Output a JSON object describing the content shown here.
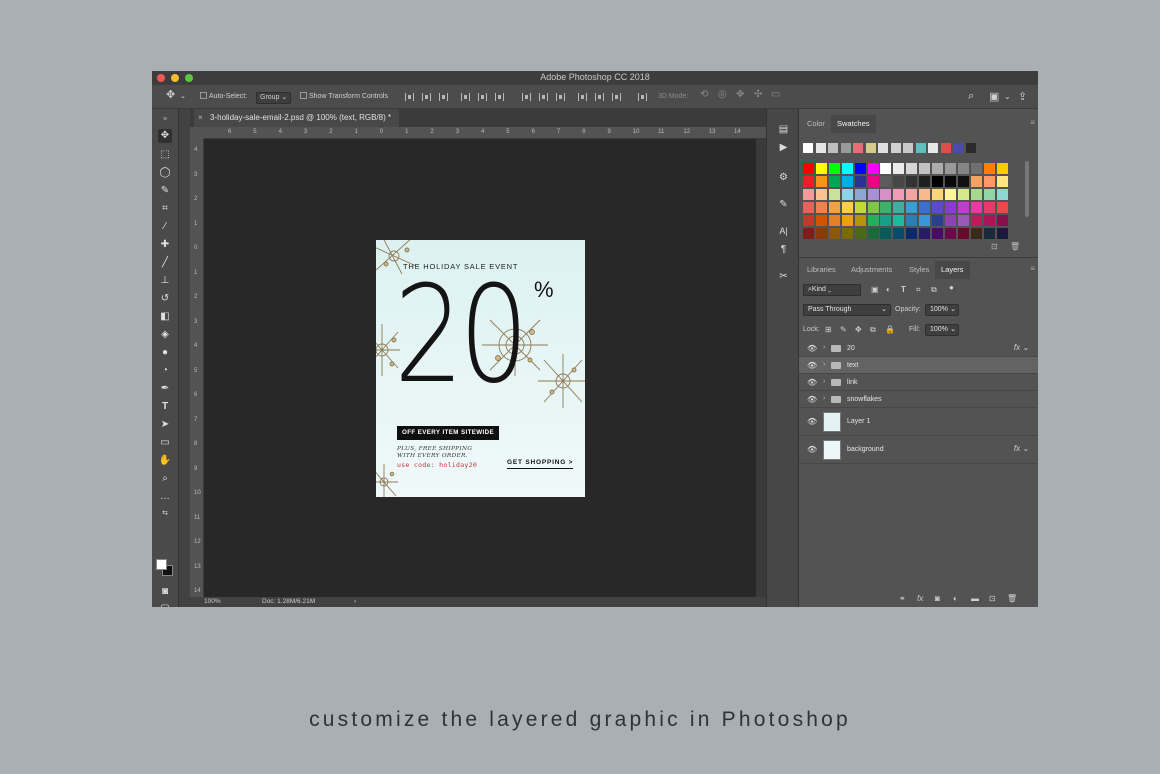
{
  "app": {
    "title": "Adobe Photoshop CC 2018"
  },
  "options_bar": {
    "move_icon": "move-icon",
    "auto_select_label": "Auto-Select:",
    "auto_select_value": "Group",
    "transform_label": "Show Transform Controls",
    "mode_label": "3D Mode:"
  },
  "document": {
    "tab_label": "3-holiday-sale-email-2.psd @ 100% (text, RGB/8) *",
    "ruler_top": [
      "6",
      "5",
      "4",
      "3",
      "2",
      "1",
      "0",
      "1",
      "2",
      "3",
      "4",
      "5",
      "6",
      "7",
      "8",
      "9",
      "10",
      "11",
      "12",
      "13",
      "14"
    ],
    "ruler_left": [
      "4",
      "3",
      "2",
      "1",
      "0",
      "1",
      "2",
      "3",
      "4",
      "5",
      "6",
      "7",
      "8",
      "9",
      "10",
      "11",
      "12",
      "13",
      "14"
    ]
  },
  "status": {
    "zoom": "100%",
    "doc": "Doc: 1.28M/6.21M"
  },
  "design": {
    "event": "THE HOLIDAY SALE EVENT",
    "big_number": "20",
    "percent": "%",
    "banner": "OFF EVERY ITEM SITEWIDE",
    "plus_line1": "PLUS, FREE SHIPPING",
    "plus_line2": "WITH EVERY ORDER.",
    "code": "use code: holiday20",
    "cta": "GET SHOPPING >"
  },
  "color_panel": {
    "tabs": [
      "Color",
      "Swatches"
    ],
    "active_tab": "Swatches",
    "top_row": [
      "#ffffff",
      "#e6e6e6",
      "#bfbfbf",
      "#9a9a9a",
      "#e66c75",
      "#d5cc8c",
      "#e0e0e0",
      "#d0d0d0",
      "#c8c8c8",
      "#5fc0c0",
      "#e8e8e8",
      "#e54b4b",
      "#4a4ab0",
      "#2a2a2a"
    ],
    "grid": [
      [
        "#ff0000",
        "#ffff00",
        "#00ff00",
        "#00ffff",
        "#0000ff",
        "#ff00ff",
        "#ffffff",
        "#ebebeb",
        "#d6d6d6",
        "#c2c2c2",
        "#adadad",
        "#999999",
        "#858585",
        "#707070",
        "#ff8000",
        "#ffcc00"
      ],
      [
        "#ee1c25",
        "#f7941d",
        "#00a651",
        "#00aeef",
        "#2e3192",
        "#ec008c",
        "#5c5c5c",
        "#474747",
        "#333333",
        "#1f1f1f",
        "#000000",
        "#0a0a0a",
        "#111111",
        "#f4a460",
        "#ff9966",
        "#ffe680"
      ],
      [
        "#f49a9a",
        "#fbc38f",
        "#c8e29c",
        "#8fd3e8",
        "#8ea6d6",
        "#a88fd6",
        "#d68fc8",
        "#f49ab8",
        "#f7a3a3",
        "#f9b98c",
        "#fdd47a",
        "#fff59a",
        "#d4ea8c",
        "#a6d98f",
        "#8fd6a8",
        "#8fd6d0"
      ],
      [
        "#e8615b",
        "#f47f4a",
        "#f9a13a",
        "#ffd03a",
        "#c2d93a",
        "#7ec64a",
        "#3ab26a",
        "#3ab2a0",
        "#3a9ed6",
        "#3a6ed6",
        "#5a4ad6",
        "#8a3ad6",
        "#c23ad6",
        "#e83aa6",
        "#e83a6a",
        "#e84a4a"
      ],
      [
        "#c0392b",
        "#d35400",
        "#e67e22",
        "#f39c12",
        "#b7950b",
        "#27ae60",
        "#16a085",
        "#1abc9c",
        "#2980b9",
        "#3498db",
        "#2c3e91",
        "#8e44ad",
        "#9b59b6",
        "#c2185b",
        "#ad1457",
        "#880e4f"
      ],
      [
        "#7f1d1d",
        "#8a3a0a",
        "#8a5a0a",
        "#7a6a0a",
        "#4a6a1a",
        "#1a6a3a",
        "#0a5a5a",
        "#0a4a6a",
        "#0a2a6a",
        "#2a1a6a",
        "#4a0a6a",
        "#6a0a4a",
        "#6a0a2a",
        "#3a2a1a",
        "#1a2a3a",
        "#1a1a3a"
      ]
    ]
  },
  "layers_panel": {
    "tabs": [
      "Libraries",
      "Adjustments",
      "Styles",
      "Layers"
    ],
    "active_tab": "Layers",
    "filter": "Kind",
    "blend_mode": "Pass Through",
    "opacity_label": "Opacity:",
    "opacity": "100%",
    "lock_label": "Lock:",
    "fill_label": "Fill:",
    "fill": "100%",
    "layers": [
      {
        "name": "20",
        "type": "group",
        "fx": true,
        "selected": false
      },
      {
        "name": "text",
        "type": "group",
        "fx": false,
        "selected": true
      },
      {
        "name": "link",
        "type": "group",
        "fx": false,
        "selected": false
      },
      {
        "name": "snowflakes",
        "type": "group",
        "fx": false,
        "selected": false
      },
      {
        "name": "Layer 1",
        "type": "pixel",
        "fx": false,
        "selected": false
      },
      {
        "name": "background",
        "type": "pixel",
        "fx": true,
        "selected": false
      }
    ]
  },
  "caption": "customize the layered graphic in Photoshop"
}
